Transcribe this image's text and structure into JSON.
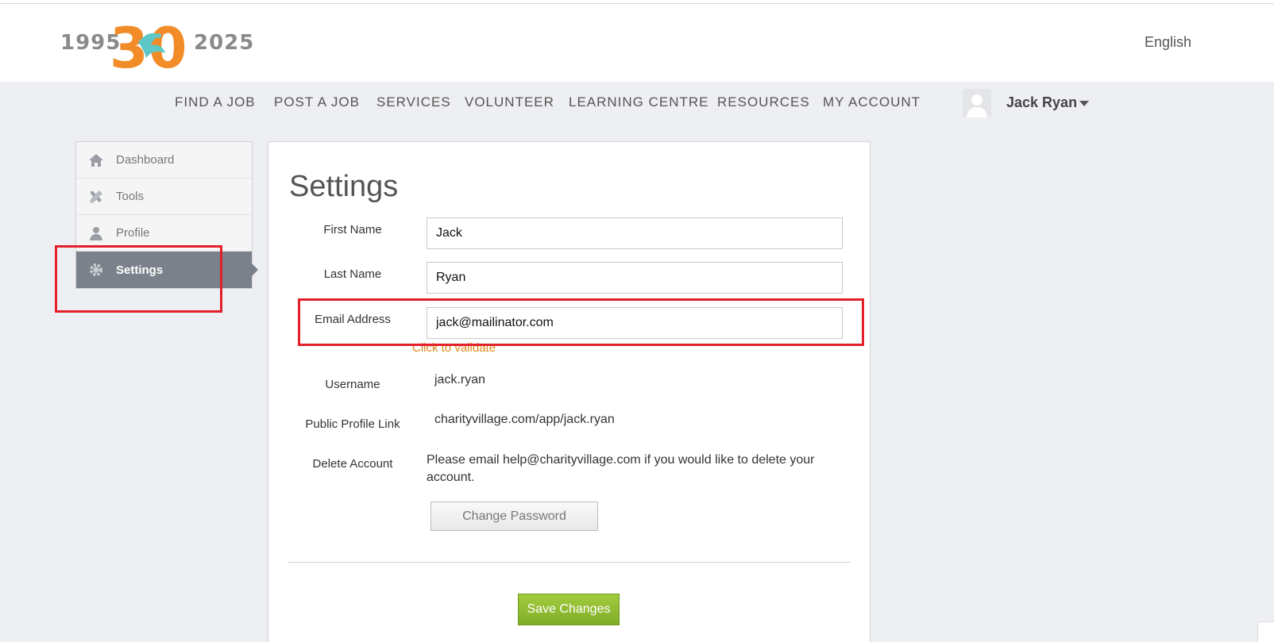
{
  "header": {
    "logo": {
      "year_left": "1995",
      "year_right": "2025",
      "anniversary": "30"
    },
    "language": "English"
  },
  "nav": {
    "items": [
      "FIND A JOB",
      "POST A JOB",
      "SERVICES",
      "VOLUNTEER",
      "LEARNING CENTRE",
      "RESOURCES",
      "MY ACCOUNT"
    ],
    "user_name": "Jack Ryan"
  },
  "sidebar": {
    "items": [
      {
        "label": "Dashboard",
        "icon": "home-icon"
      },
      {
        "label": "Tools",
        "icon": "tools-icon"
      },
      {
        "label": "Profile",
        "icon": "user-icon"
      },
      {
        "label": "Settings",
        "icon": "gear-icon",
        "active": true
      }
    ]
  },
  "settings": {
    "title": "Settings",
    "first_name_label": "First Name",
    "first_name_value": "Jack",
    "last_name_label": "Last Name",
    "last_name_value": "Ryan",
    "email_label": "Email Address",
    "email_value": "jack@mailinator.com",
    "validate_link": "Click to validate",
    "username_label": "Username",
    "username_value": "jack.ryan",
    "profile_link_label": "Public Profile Link",
    "profile_link_value": "charityvillage.com/app/jack.ryan",
    "delete_label": "Delete Account",
    "delete_text": "Please email help@charityvillage.com if you would like to delete your account.",
    "change_password_label": "Change Password",
    "save_label": "Save Changes"
  },
  "colors": {
    "accent_orange": "#f28c28",
    "save_green": "#8fbb32",
    "highlight_red": "#e3202a",
    "sidebar_active": "#7a818a"
  }
}
